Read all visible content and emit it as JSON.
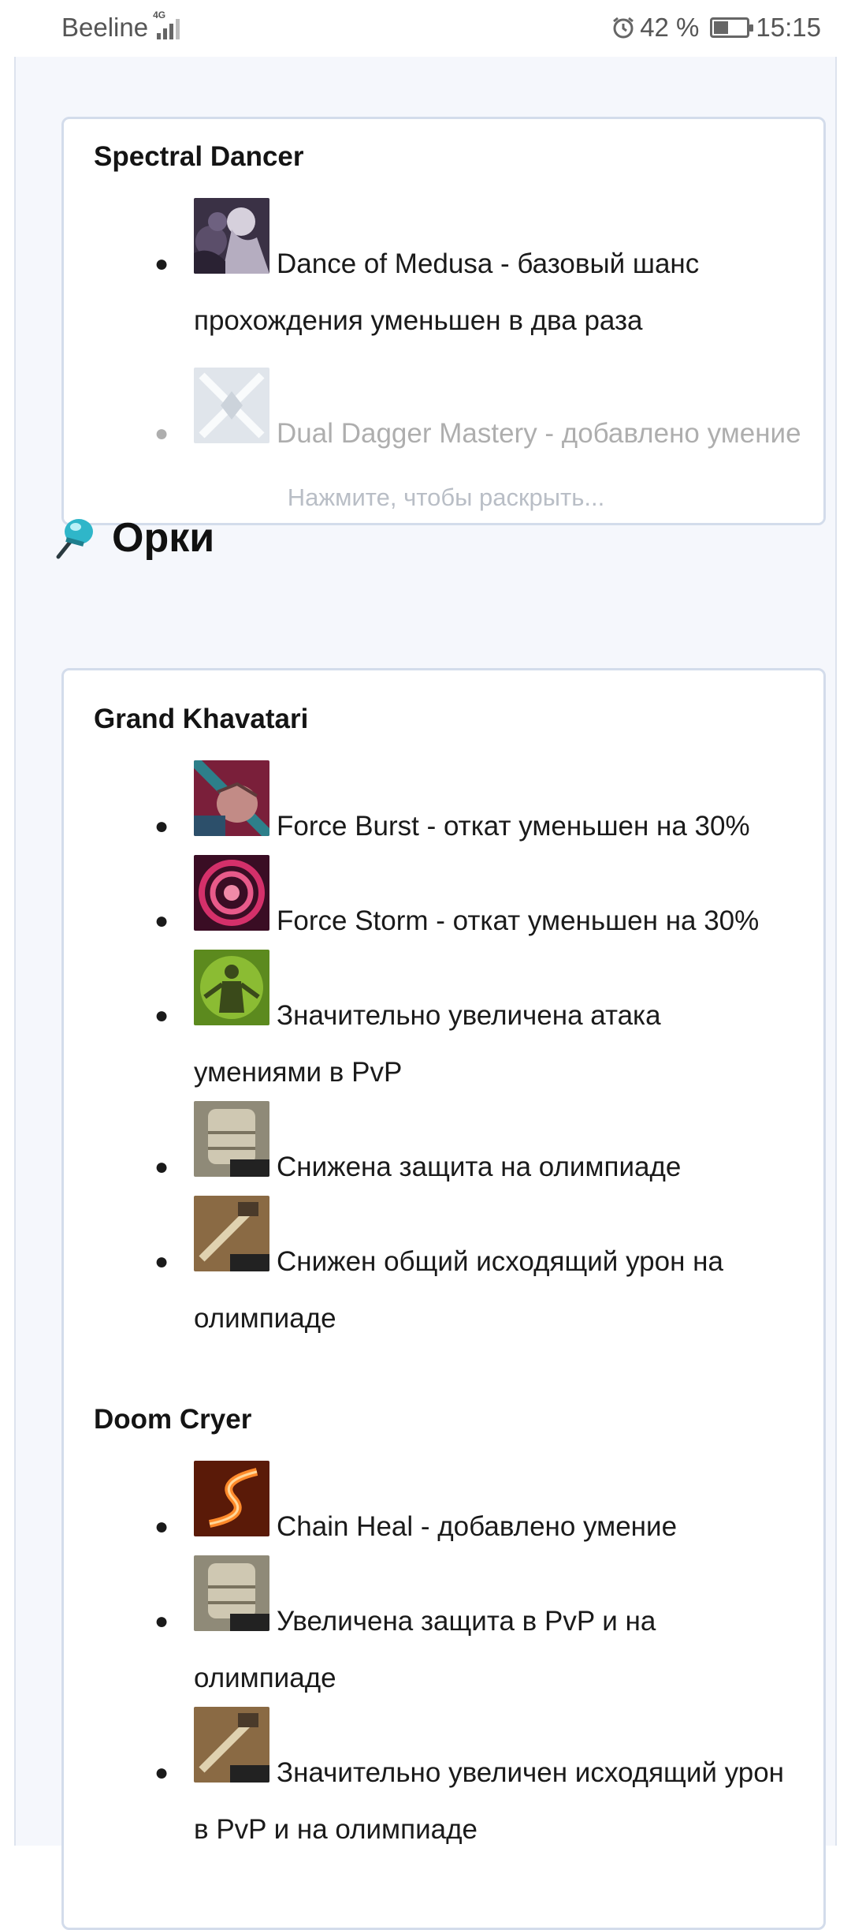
{
  "status_bar": {
    "carrier": "Beeline",
    "network": "4G",
    "battery": "42 %",
    "time": "15:15"
  },
  "section1": {
    "class_name": "Spectral Dancer",
    "skills": [
      {
        "line1": "Dance of Medusa - базовый шанс",
        "line2": "прохождения уменьшен в два раза",
        "icon": "medusa-icon"
      },
      {
        "line1": "Dual Dagger Mastery - добавлено умение",
        "line2": "",
        "icon": "dual-dagger-icon"
      }
    ],
    "expand_label": "Нажмите, чтобы раскрыть..."
  },
  "section2": {
    "heading": "Орки",
    "classes": [
      {
        "class_name": "Grand Khavatari",
        "skills": [
          {
            "line1": "Force Burst - откат уменьшен на 30%",
            "line2": "",
            "icon": "force-burst-icon"
          },
          {
            "line1": "Force Storm - откат уменьшен на 30%",
            "line2": "",
            "icon": "force-storm-icon"
          },
          {
            "line1": "Значительно увеличена атака",
            "line2": "умениями в PvP",
            "icon": "pvp-attack-icon"
          },
          {
            "line1": "Снижена защита на олимпиаде",
            "line2": "",
            "icon": "pvp-armor-icon"
          },
          {
            "line1": "Снижен общий исходящий урон на",
            "line2": "олимпиаде",
            "icon": "pvp-weapon-icon"
          }
        ]
      },
      {
        "class_name": "Doom Cryer",
        "skills": [
          {
            "line1": "Chain Heal - добавлено умение",
            "line2": "",
            "icon": "chain-heal-icon"
          },
          {
            "line1": "Увеличена защита в PvP и на",
            "line2": "олимпиаде",
            "icon": "pvp-armor-icon"
          },
          {
            "line1": "Значительно увеличен исходящий урон",
            "line2": "в PvP и на олимпиаде",
            "icon": "pvp-weapon-icon"
          }
        ]
      }
    ]
  },
  "pvp_badge": "PvP"
}
